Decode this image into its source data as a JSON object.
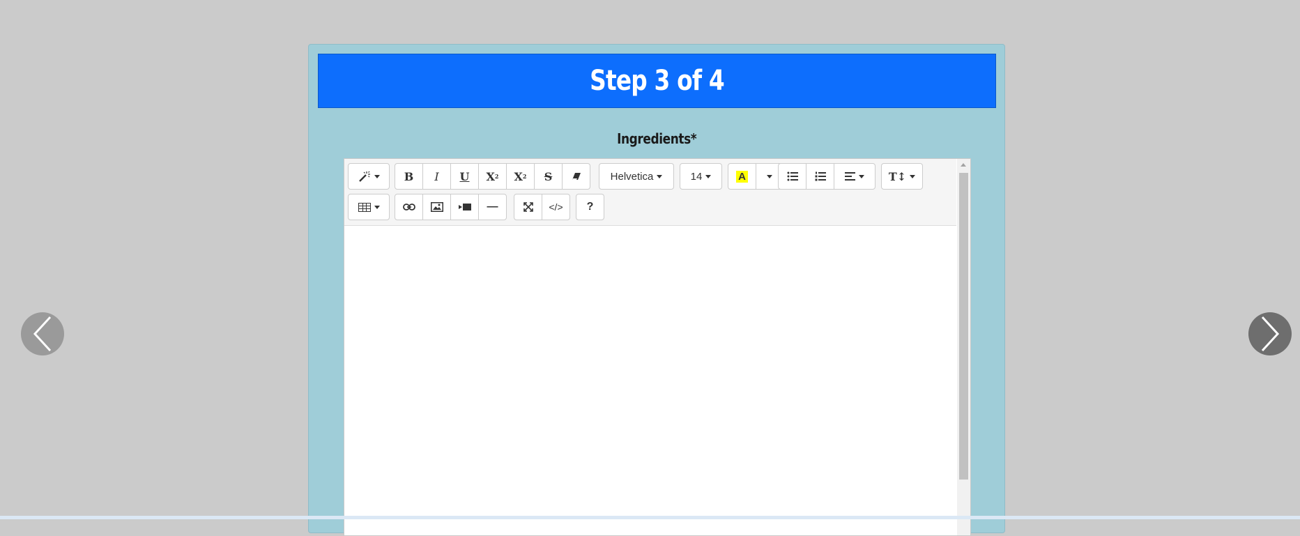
{
  "navigation": {
    "prev_icon": "chevron-left-icon",
    "next_icon": "chevron-right-icon"
  },
  "header": {
    "title": "Step 3 of 4"
  },
  "field": {
    "label": "Ingredients*"
  },
  "toolbar": {
    "style_icon": "magic-wand-icon",
    "bold_label": "B",
    "italic_label": "I",
    "underline_label": "U",
    "superscript_label": "X",
    "subscript_label": "X",
    "strikethrough_label": "S",
    "clear_format_icon": "eraser-icon",
    "font_name": "Helvetica",
    "font_size": "14",
    "color_label": "A",
    "unordered_list_icon": "bullet-list-icon",
    "ordered_list_icon": "numbered-list-icon",
    "paragraph_icon": "align-left-icon",
    "line_height_label": "T↕",
    "table_icon": "table-icon",
    "link_icon": "link-icon",
    "picture_icon": "image-icon",
    "video_icon": "video-icon",
    "hr_label": "—",
    "fullscreen_icon": "fullscreen-icon",
    "codeview_label": "</>",
    "help_label": "?"
  },
  "colors": {
    "background": "#cbcbcb",
    "card": "#9fcdd8",
    "header": "#0d6efd",
    "highlight": "#ffff00"
  }
}
